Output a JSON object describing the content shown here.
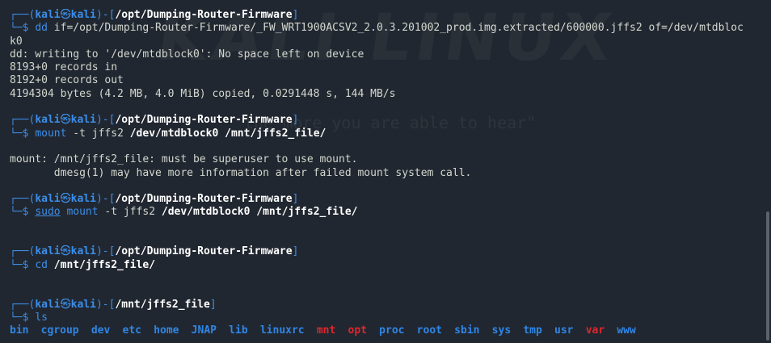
{
  "watermark": {
    "title": "KALI LINUX",
    "quote": "the more you are able to hear\""
  },
  "prompt": {
    "user": "kali",
    "at": "㉿",
    "host": "kali"
  },
  "blocks": [
    {
      "dir": "/opt/Dumping-Router-Firmware",
      "cmd": "dd",
      "args": " if=/opt/Dumping-Router-Firmware/_FW_WRT1900ACSV2_2.0.3.201002_prod.img.extracted/600000.jffs2 of=/dev/mtdbloc",
      "wrap": "k0",
      "output": [
        "dd: writing to '/dev/mtdblock0': No space left on device",
        "8193+0 records in",
        "8192+0 records out",
        "4194304 bytes (4.2 MB, 4.0 MiB) copied, 0.0291448 s, 144 MB/s"
      ]
    },
    {
      "dir": "/opt/Dumping-Router-Firmware",
      "cmd": "mount",
      "args_plain": " -t jffs2 ",
      "args_bold": "/dev/mtdblock0 /mnt/jffs2_file/",
      "output": [
        "mount: /mnt/jffs2_file: must be superuser to use mount.",
        "       dmesg(1) may have more information after failed mount system call."
      ]
    },
    {
      "dir": "/opt/Dumping-Router-Firmware",
      "pre": "sudo",
      "cmd": " mount",
      "args_plain": " -t jffs2 ",
      "args_bold": "/dev/mtdblock0 /mnt/jffs2_file/"
    },
    {
      "dir": "/opt/Dumping-Router-Firmware",
      "cmd": "cd",
      "args_bold": " /mnt/jffs2_file/"
    },
    {
      "dir": "/mnt/jffs2_file",
      "cmd": "ls"
    }
  ],
  "ls_output": [
    {
      "name": "bin",
      "color": "#2f86e6"
    },
    {
      "name": "cgroup",
      "color": "#2f86e6"
    },
    {
      "name": "dev",
      "color": "#2f86e6"
    },
    {
      "name": "etc",
      "color": "#2f86e6"
    },
    {
      "name": "home",
      "color": "#2f86e6"
    },
    {
      "name": "JNAP",
      "color": "#2f86e6"
    },
    {
      "name": "lib",
      "color": "#2f86e6"
    },
    {
      "name": "linuxrc",
      "color": "#2f86e6"
    },
    {
      "name": "mnt",
      "color": "#e0262d"
    },
    {
      "name": "opt",
      "color": "#e0262d"
    },
    {
      "name": "proc",
      "color": "#2f86e6"
    },
    {
      "name": "root",
      "color": "#2f86e6"
    },
    {
      "name": "sbin",
      "color": "#2f86e6"
    },
    {
      "name": "sys",
      "color": "#2f86e6"
    },
    {
      "name": "tmp",
      "color": "#2f86e6"
    },
    {
      "name": "usr",
      "color": "#2f86e6"
    },
    {
      "name": "var",
      "color": "#e0262d"
    },
    {
      "name": "www",
      "color": "#2f86e6"
    }
  ]
}
